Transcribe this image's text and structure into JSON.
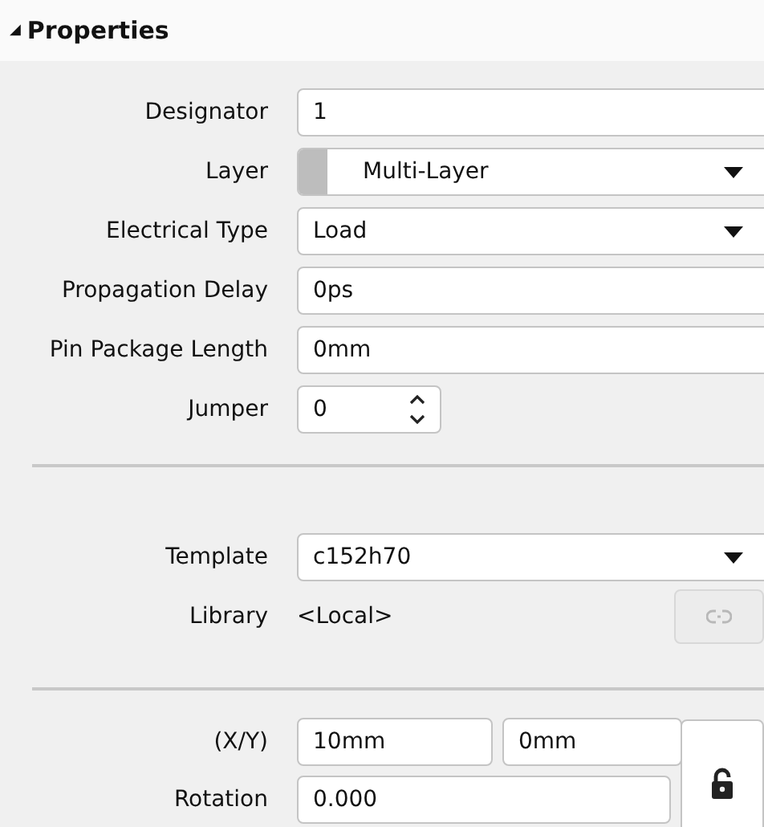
{
  "header": {
    "arrow": "◢",
    "title": "Properties",
    "expanded": true
  },
  "sections": [
    {
      "rows": [
        {
          "kind": "text",
          "label": "Designator",
          "value": "1"
        },
        {
          "kind": "select",
          "label": "Layer",
          "value": "Multi-Layer",
          "swatch": true
        },
        {
          "kind": "select",
          "label": "Electrical Type",
          "value": "Load"
        },
        {
          "kind": "text",
          "label": "Propagation Delay",
          "value": "0ps"
        },
        {
          "kind": "text",
          "label": "Pin Package Length",
          "value": "0mm"
        },
        {
          "kind": "spin",
          "label": "Jumper",
          "value": "0"
        }
      ]
    },
    {
      "rows": [
        {
          "kind": "select",
          "label": "Template",
          "value": "c152h70"
        },
        {
          "kind": "static",
          "label": "Library",
          "value": "<Local>",
          "link_disabled": true
        }
      ]
    },
    {
      "rows": [
        {
          "kind": "pair",
          "label": "(X/Y)",
          "value": "10mm",
          "value2": "0mm"
        },
        {
          "kind": "text",
          "label": "Rotation",
          "value": "0.000"
        }
      ],
      "lock": {
        "locked": false
      }
    }
  ]
}
